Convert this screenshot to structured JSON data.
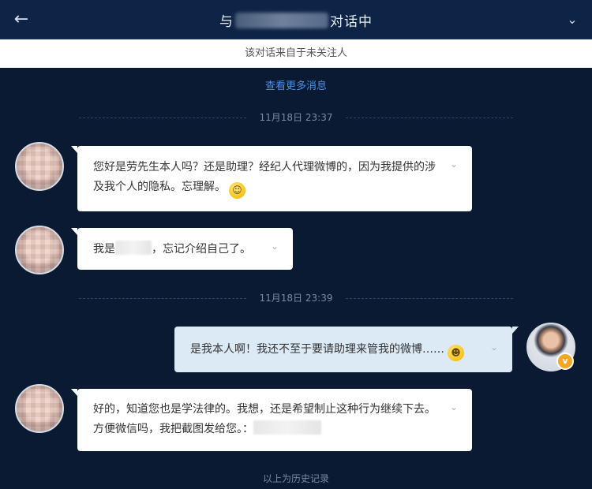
{
  "header": {
    "title_prefix": "与",
    "title_suffix": "对话中",
    "back_icon": "left-arrow-icon",
    "collapse_icon": "chevron-down-icon"
  },
  "notice": "该对话来自于未关注人",
  "more_link": "查看更多消息",
  "messages_section_1": {
    "time": "11月18日 23:37"
  },
  "messages": [
    {
      "sender": "friend",
      "text": "您好是劳先生本人吗？还是助理？经纪人代理微博的，因为我提供的涉及我个人的隐私。忘理解。",
      "emoji": "smile"
    },
    {
      "sender": "friend",
      "text_before": "我是",
      "text_after": "，忘记介绍自己了。"
    },
    {
      "sender": "me",
      "text": "是我本人啊！我还不至于要请助理来管我的微博……",
      "emoji": "laugh"
    },
    {
      "sender": "friend",
      "text": "好的，知道您也是学法律的。我想，还是希望制止这种行为继续下去。方便微信吗，我把截图发给您。："
    }
  ],
  "messages_section_2": {
    "time": "11月18日 23:39"
  },
  "history": "以上为历史记录",
  "colors": {
    "background": "#0b1a33",
    "header": "#0e2447",
    "link": "#4e8fe6",
    "my_bubble": "#dceaf6",
    "badge": "#f5a623"
  }
}
